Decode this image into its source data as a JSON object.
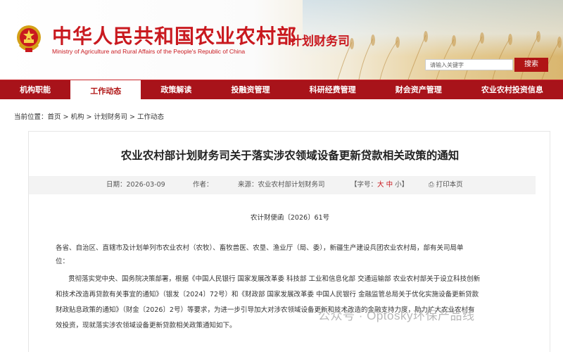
{
  "header": {
    "title_cn": "中华人民共和国农业农村部",
    "title_en": "Ministry of Agriculture and Rural Affairs of the People's Republic of China",
    "department": "计划财务司",
    "search_placeholder": "请输入关键字",
    "search_button": "搜索"
  },
  "nav": {
    "items": [
      {
        "label": "机构职能"
      },
      {
        "label": "工作动态"
      },
      {
        "label": "政策解读"
      },
      {
        "label": "投融资管理"
      },
      {
        "label": "科研经费管理"
      },
      {
        "label": "财会资产管理"
      },
      {
        "label": "农业农村投资信息"
      }
    ],
    "active_index": 1
  },
  "breadcrumb": "当前位置：首页 > 机构 > 计划财务司 > 工作动态",
  "article": {
    "title": "农业农村部计划财务司关于落实涉农领域设备更新贷款相关政策的通知",
    "date_label": "日期：2026-03-09",
    "author_label": "作者：",
    "source_label": "来源：农业农村部计划财务司",
    "font_size_prefix": "【字号：",
    "font_large": "大",
    "font_medium": "中",
    "font_small": "小",
    "font_size_suffix": "】",
    "print_label": "打印本页",
    "doc_number": "农计财便函〔2026〕61号",
    "recipients_line1": "各省、自治区、直辖市及计划单列市农业农村（农牧）、畜牧兽医、农垦、渔业厅（局、委），新疆生产建设兵团农业农村局，部有关司局单",
    "recipients_line2": "位：",
    "body_line1": "贯彻落实党中央、国务院决策部署，根据《中国人民银行 国家发展改革委 科技部 工业和信息化部 交通运输部 农业农村部关于设立科技创新",
    "body_line2": "和技术改造再贷款有关事宜的通知》（银发〔2024〕72号）和《财政部 国家发展改革委 中国人民银行 金融监管总局关于优化实施设备更新贷款",
    "body_line3": "财政贴息政策的通知》（财金〔2026〕2号）等要求，为进一步引导加大对涉农领域设备更新和技术改造的金融支持力度，助力扩大农业农村有",
    "body_line4": "效投资，现就落实涉农领域设备更新贷款相关政策通知如下。"
  },
  "watermark": "公众号 · Optosky环保产品线",
  "colors": {
    "brand_red": "#c9191f",
    "nav_red": "#a8131a",
    "meta_bg": "#f3f3f3"
  }
}
